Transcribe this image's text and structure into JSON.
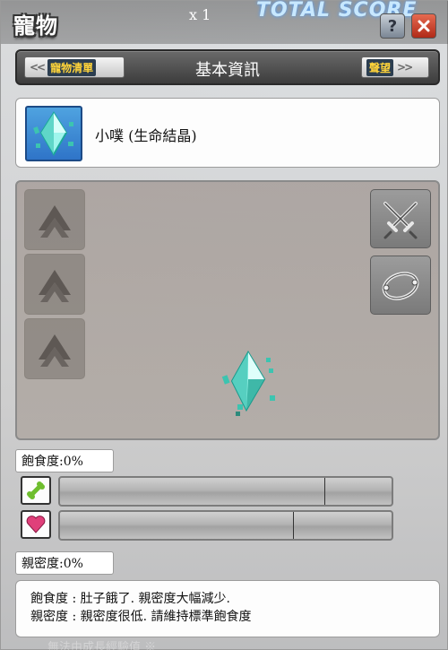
{
  "hud": {
    "multiplier": "x 1",
    "score_label": "TOTAL SCORE"
  },
  "window": {
    "title": "寵物",
    "help_label": "?",
    "close_label": "✕"
  },
  "nav": {
    "left_arrows": "<<",
    "left_label": "寵物清單",
    "title": "基本資訊",
    "right_label": "聲望",
    "right_arrows": ">>"
  },
  "pet": {
    "name": "小噗 (生命結晶)",
    "icon": "life-crystal-icon"
  },
  "skills": {
    "left_slots": [
      "locked-slot-icon",
      "locked-slot-icon",
      "locked-slot-icon"
    ],
    "right_actions": [
      "crossed-swords-icon",
      "ring-orbit-icon"
    ]
  },
  "stats": {
    "hunger": {
      "label": "飽食度:0%",
      "value": 0,
      "icon": "bone-icon",
      "color": "#7fd04a"
    },
    "intimacy": {
      "label": "親密度:0%",
      "value": 0,
      "icon": "heart-icon",
      "color": "#e0407a"
    }
  },
  "description": {
    "line1": "飽食度 : 肚子餓了. 親密度大幅減少.",
    "line2": "親密度 : 親密度很低. 請維持標準飽食度"
  },
  "footer": {
    "faded_text": "無法由成長經驗值 ※"
  }
}
